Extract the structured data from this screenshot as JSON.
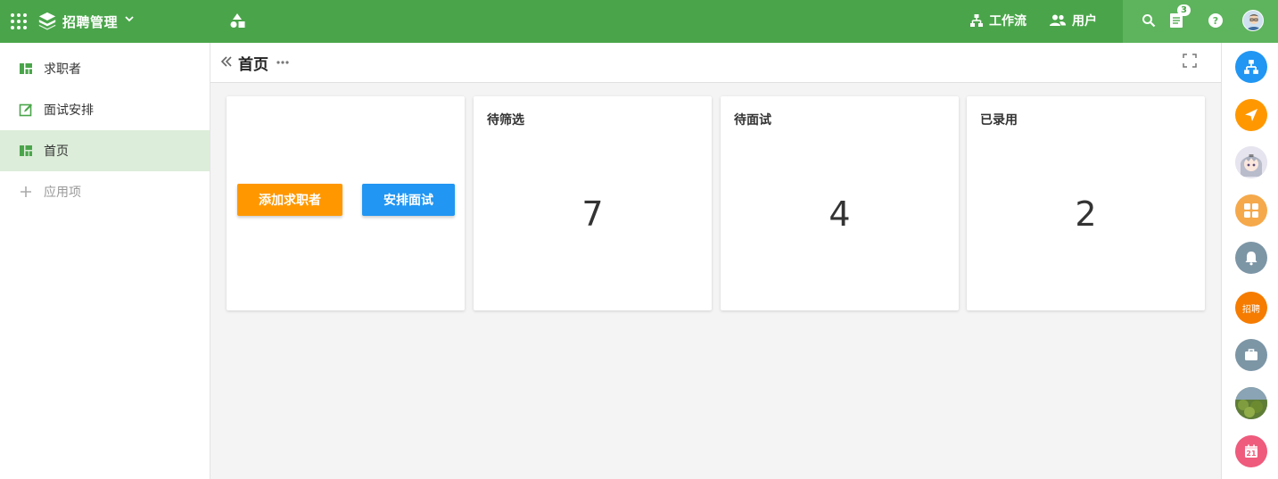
{
  "topbar": {
    "app_name": "招聘管理",
    "workflow_label": "工作流",
    "users_label": "用户",
    "notification_count": "3"
  },
  "sidebar": {
    "items": [
      {
        "label": "求职者",
        "icon": "dashboard-icon"
      },
      {
        "label": "面试安排",
        "icon": "edit-note-icon"
      },
      {
        "label": "首页",
        "icon": "dashboard-icon",
        "active": true
      },
      {
        "label": "应用项",
        "icon": "plus-icon"
      }
    ]
  },
  "page": {
    "title": "首页"
  },
  "actions": {
    "add_applicant": "添加求职者",
    "schedule_interview": "安排面试"
  },
  "stats": [
    {
      "title": "待筛选",
      "value": "7"
    },
    {
      "title": "待面试",
      "value": "4"
    },
    {
      "title": "已录用",
      "value": "2"
    }
  ],
  "rail": {
    "items": [
      {
        "name": "workflow-icon",
        "color": "#2196f3"
      },
      {
        "name": "send-icon",
        "color": "#ff9800"
      },
      {
        "name": "user-avatar"
      },
      {
        "name": "apps-icon",
        "color": "#f5a94b"
      },
      {
        "name": "bell-icon",
        "color": "#7d96a6"
      },
      {
        "name": "group-avatar",
        "label": "招聘",
        "color": "#f57c00"
      },
      {
        "name": "briefcase-icon",
        "color": "#7d96a6"
      },
      {
        "name": "photo-avatar"
      },
      {
        "name": "calendar-icon",
        "label": "21",
        "color": "#ee5b7c"
      }
    ]
  },
  "colors": {
    "brand": "#4aa54a",
    "active_nav": "#dcedd9",
    "orange": "#ff9800",
    "blue": "#2196f3"
  }
}
